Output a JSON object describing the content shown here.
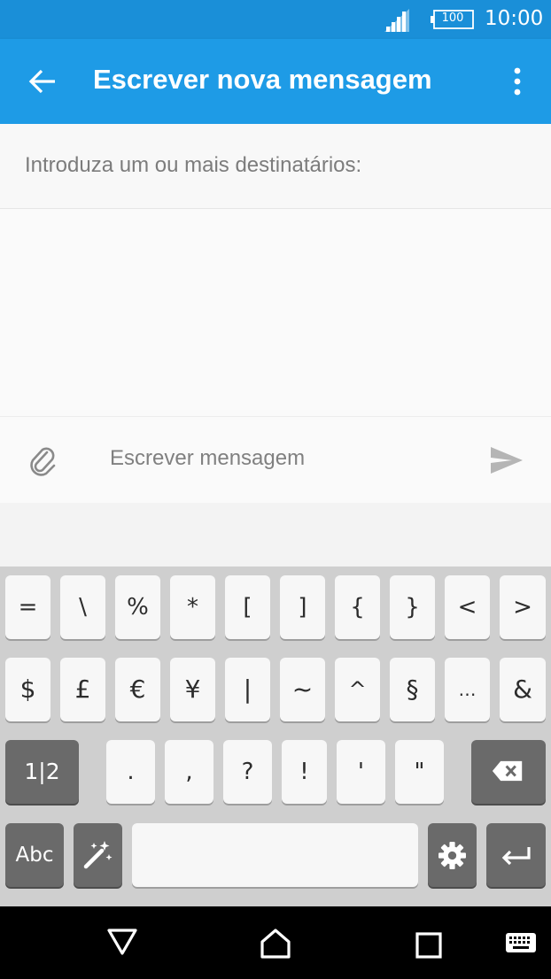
{
  "status_bar": {
    "signal_icon": "signal-icon",
    "battery_level": "100",
    "time": "10:00"
  },
  "app_bar": {
    "title": "Escrever nova mensagem",
    "back_icon": "arrow-left-icon",
    "menu_icon": "more-vert-icon"
  },
  "recipients": {
    "placeholder": "Introduza um ou mais destinatários:"
  },
  "composer": {
    "placeholder": "Escrever mensagem",
    "attach_icon": "paperclip-icon",
    "send_icon": "send-icon"
  },
  "keyboard": {
    "row1": [
      "=",
      "\\",
      "%",
      "*",
      "[",
      "]",
      "{",
      "}",
      "<",
      ">"
    ],
    "row2": [
      "$",
      "£",
      "€",
      "¥",
      "|",
      "~",
      "^",
      "§",
      "…",
      "&"
    ],
    "row3": [
      ".",
      ",",
      "?",
      "!",
      "'",
      "\""
    ],
    "page_switch": "1|2",
    "backspace_icon": "backspace-icon",
    "abc_label": "Abc",
    "magic_icon": "magic-wand-icon",
    "settings_icon": "gear-icon",
    "enter_icon": "enter-icon"
  },
  "nav_bar": {
    "back_icon": "nav-back-icon",
    "home_icon": "nav-home-icon",
    "recents_icon": "nav-recents-icon",
    "keyboard_icon": "keyboard-icon"
  },
  "colors": {
    "status_bar": "#1a8fd8",
    "app_bar": "#1e9be6",
    "keyboard_bg": "#cfcfcf",
    "key_dark": "#6a6a6a"
  }
}
